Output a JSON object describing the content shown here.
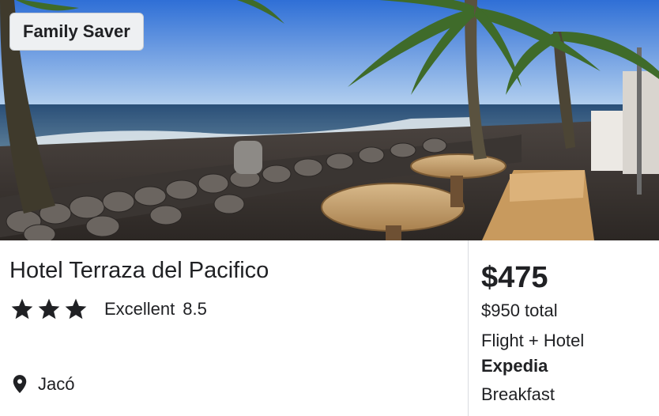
{
  "badge": {
    "label": "Family Saver"
  },
  "hotel": {
    "name": "Hotel Terraza del Pacifico",
    "star_rating": 3,
    "rating_label": "Excellent",
    "rating_score": "8.5",
    "location": "Jacó"
  },
  "pricing": {
    "price": "$475",
    "total": "$950 total",
    "package": "Flight + Hotel",
    "provider": "Expedia",
    "amenity": "Breakfast"
  },
  "icons": {
    "star": "star-icon",
    "location": "map-pin-icon"
  }
}
